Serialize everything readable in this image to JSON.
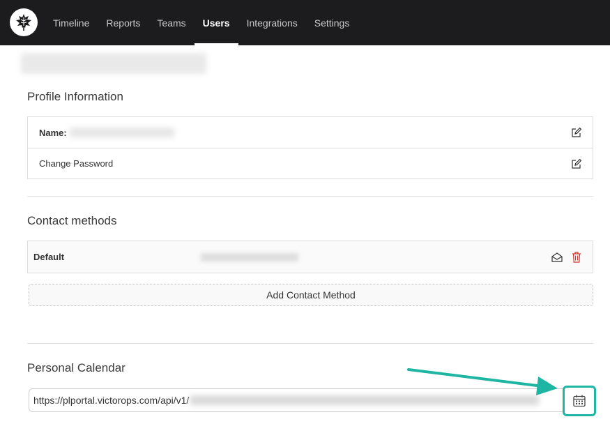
{
  "nav": {
    "items": [
      {
        "label": "Timeline",
        "active": false
      },
      {
        "label": "Reports",
        "active": false
      },
      {
        "label": "Teams",
        "active": false
      },
      {
        "label": "Users",
        "active": true
      },
      {
        "label": "Integrations",
        "active": false
      },
      {
        "label": "Settings",
        "active": false
      }
    ]
  },
  "profile": {
    "title": "Profile Information",
    "name_label": "Name:",
    "change_password": "Change Password"
  },
  "contact": {
    "title": "Contact methods",
    "default_label": "Default",
    "add_button": "Add Contact Method"
  },
  "calendar": {
    "title": "Personal Calendar",
    "url_prefix": "https://plportal.victorops.com/api/v1/"
  },
  "colors": {
    "topbar": "#1c1c1e",
    "accent": "#1fb5a3",
    "delete": "#d0342c"
  },
  "icons": {
    "logo": "leaf-icon",
    "edit": "edit-icon",
    "envelope": "envelope-open-icon",
    "trash": "trash-icon",
    "calendar": "calendar-icon"
  }
}
